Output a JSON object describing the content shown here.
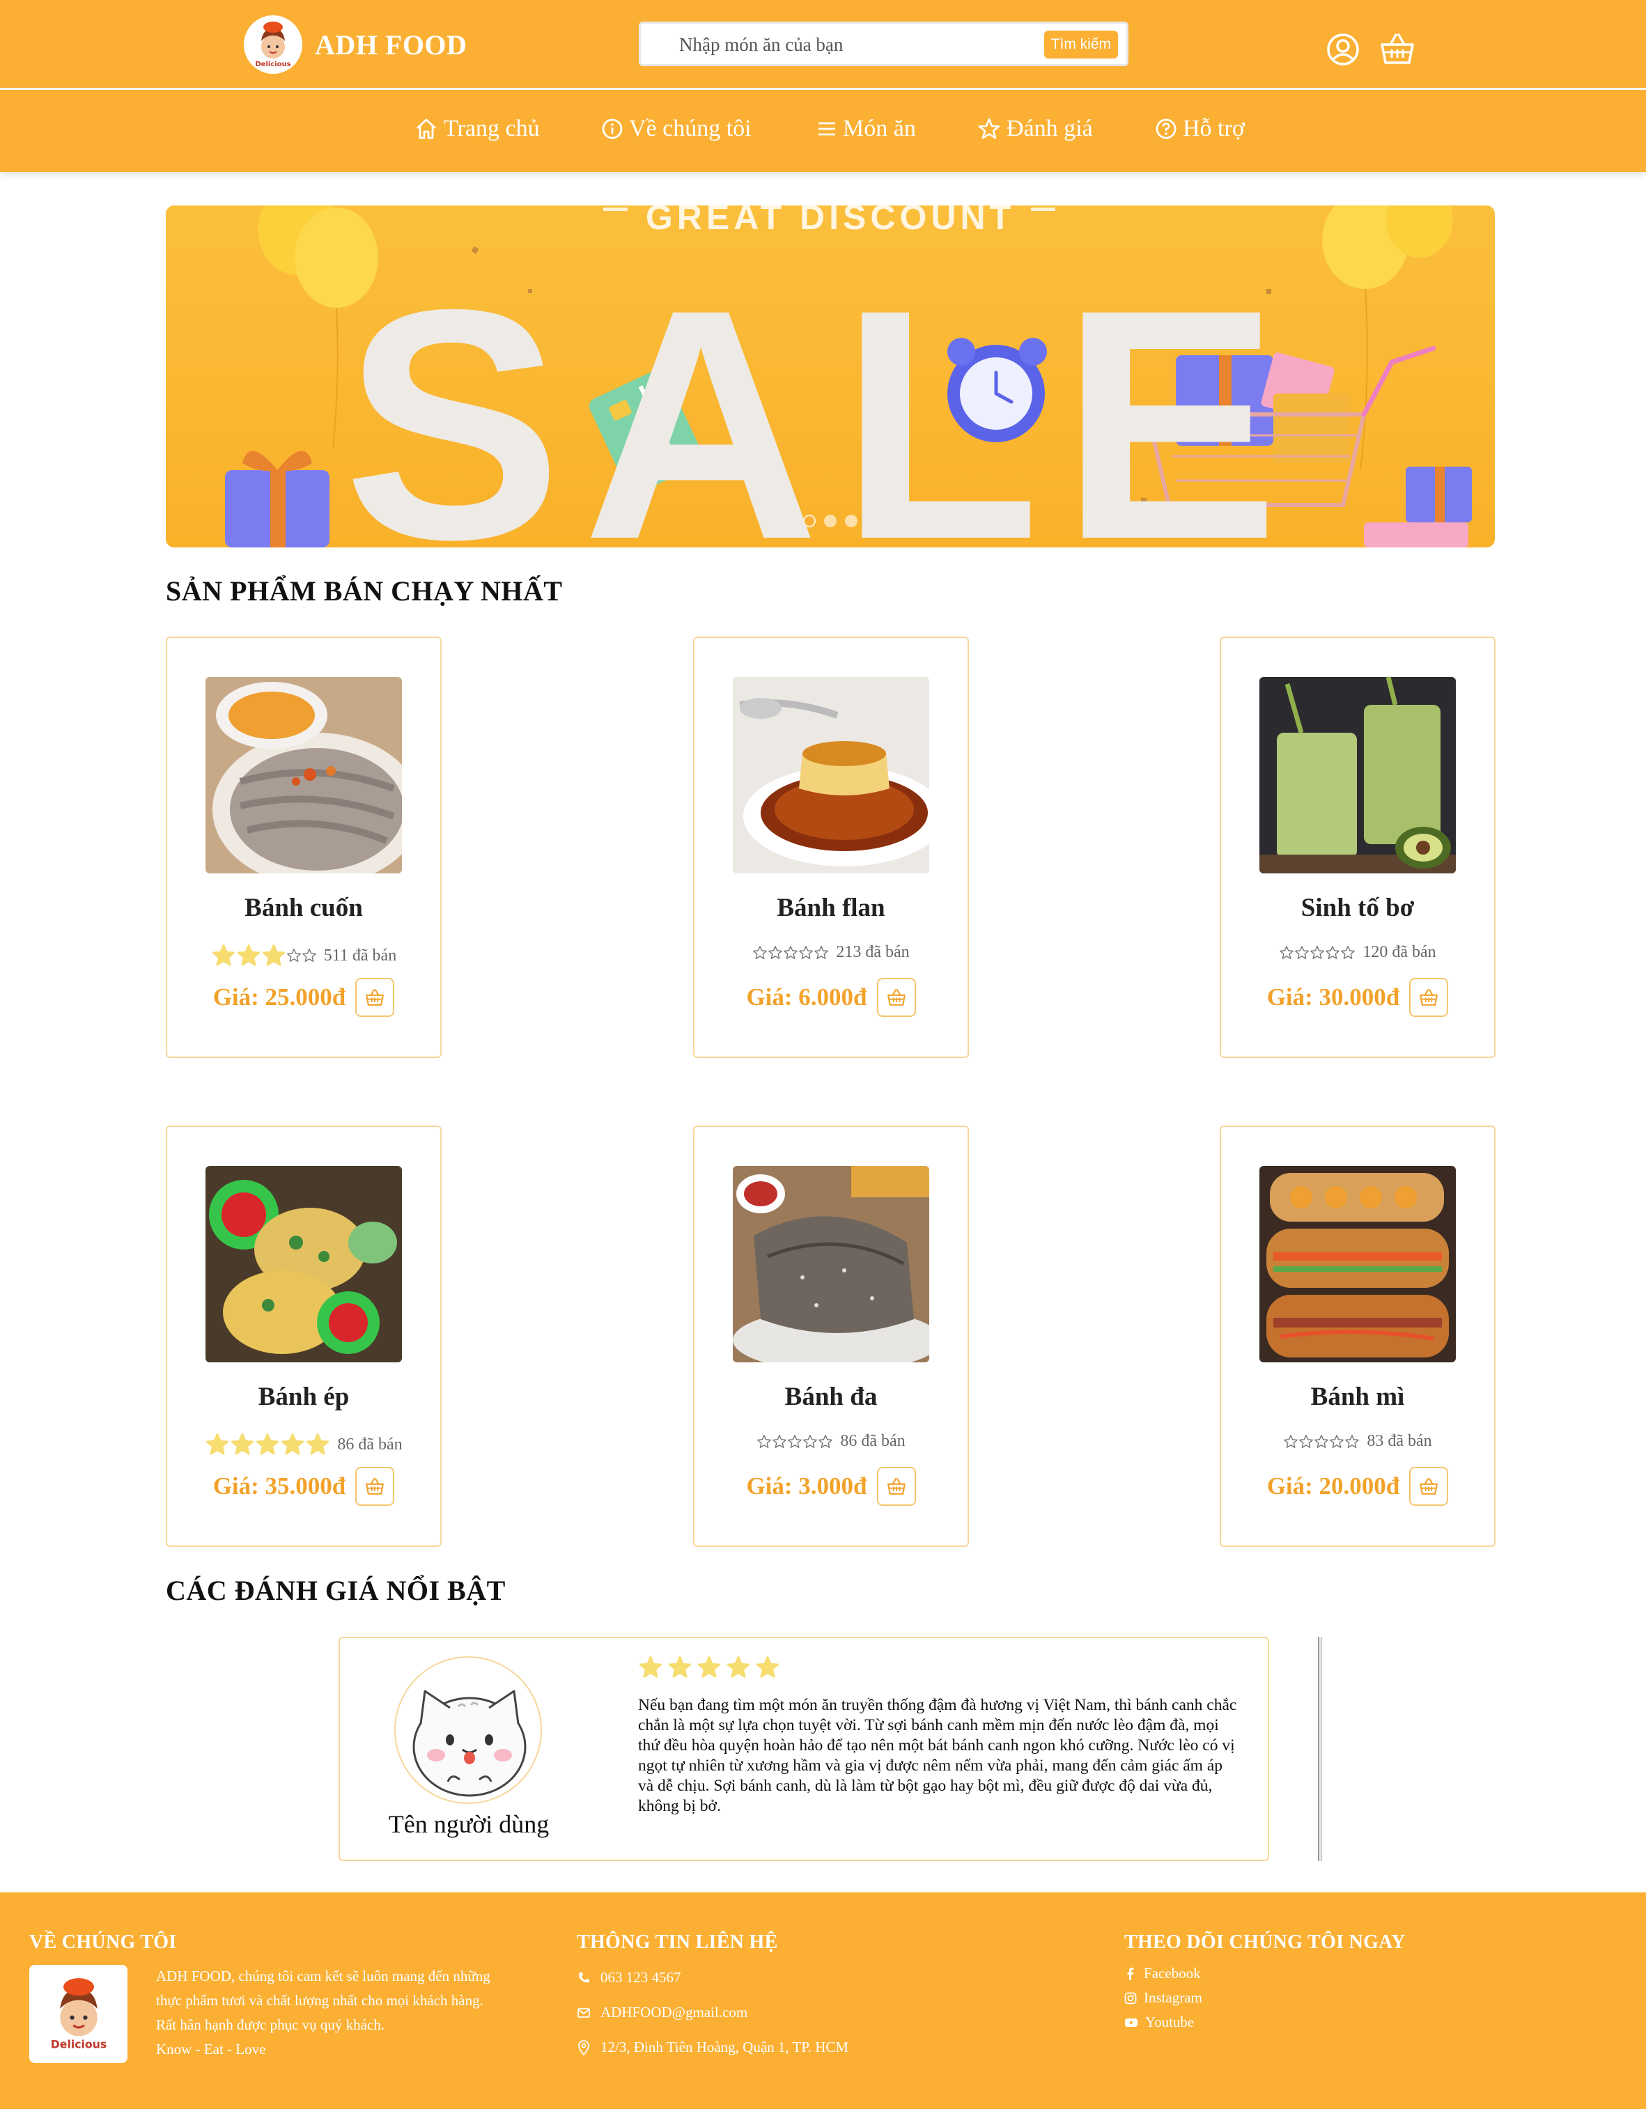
{
  "header": {
    "brand": "ADH FOOD",
    "search_placeholder": "Nhập món ăn của bạn",
    "search_button": "Tìm kiếm",
    "icons": [
      "user-icon",
      "shopping-basket-icon"
    ]
  },
  "nav": {
    "items": [
      {
        "label": "Trang chủ",
        "icon": "home-icon"
      },
      {
        "label": "Về chúng tôi",
        "icon": "info-icon"
      },
      {
        "label": "Món ăn",
        "icon": "menu-icon"
      },
      {
        "label": "Đánh giá",
        "icon": "star-icon"
      },
      {
        "label": "Hỗ trợ",
        "icon": "help-icon"
      }
    ]
  },
  "banner": {
    "headline": "GREAT DISCOUNT",
    "big_text": "SALE",
    "slides": 3,
    "active_slide": 1
  },
  "bestsellers": {
    "title": "SẢN PHẨM BÁN CHẠY NHẤT",
    "products": [
      {
        "name": "Bánh cuốn",
        "rating": 3,
        "sold": "511 đã bán",
        "price": "Giá: 25.000đ"
      },
      {
        "name": "Bánh flan",
        "rating": 0,
        "sold": "213 đã bán",
        "price": "Giá: 6.000đ"
      },
      {
        "name": "Sinh tố bơ",
        "rating": 0,
        "sold": "120 đã bán",
        "price": "Giá: 30.000đ"
      },
      {
        "name": "Bánh ép",
        "rating": 5,
        "sold": "86 đã bán",
        "price": "Giá: 35.000đ"
      },
      {
        "name": "Bánh đa",
        "rating": 0,
        "sold": "86 đã bán",
        "price": "Giá: 3.000đ"
      },
      {
        "name": "Bánh mì",
        "rating": 0,
        "sold": "83 đã bán",
        "price": "Giá: 20.000đ"
      }
    ]
  },
  "reviews": {
    "title": "CÁC ĐÁNH GIÁ NỔI BẬT",
    "items": [
      {
        "user": "Tên người dùng",
        "rating": 5,
        "text": "Nếu bạn đang tìm một món ăn truyền thống đậm đà hương vị Việt Nam, thì bánh canh chắc chắn là một sự lựa chọn tuyệt vời. Từ sợi bánh canh mềm mịn đến nước lèo đậm đà, mọi thứ đều hòa quyện hoàn hảo để tạo nên một bát bánh canh ngon khó cưỡng. Nước lèo có vị ngọt tự nhiên từ xương hầm và gia vị được nêm nếm vừa phải, mang đến cảm giác ấm áp và dễ chịu. Sợi bánh canh, dù là làm từ bột gạo hay bột mì, đều giữ được độ dai vừa đủ, không bị bở."
      }
    ]
  },
  "footer": {
    "about_title": "VỀ CHÚNG TÔI",
    "about_lines": [
      "ADH FOOD, chúng tôi cam kết sẽ luôn mang đến những",
      "thực phẩm tươi và chất lượng nhất cho mọi khách hàng.",
      "Rất hân hạnh được phục vụ quý khách.",
      "Know - Eat - Love"
    ],
    "contact_title": "THÔNG TIN LIÊN HỆ",
    "phone": "063 123 4567",
    "email": "ADHFOOD@gmail.com",
    "address": "12/3, Đinh Tiên Hoàng, Quận 1, TP. HCM",
    "social_title": "THEO DÕI CHÚNG TÔI NGAY",
    "social": [
      "Facebook",
      "Instagram",
      "Youtube"
    ]
  },
  "colors": {
    "primary": "#fbb034",
    "price": "#f2a22a",
    "star": "#f7dc6f",
    "card_border": "#f6d79a"
  }
}
